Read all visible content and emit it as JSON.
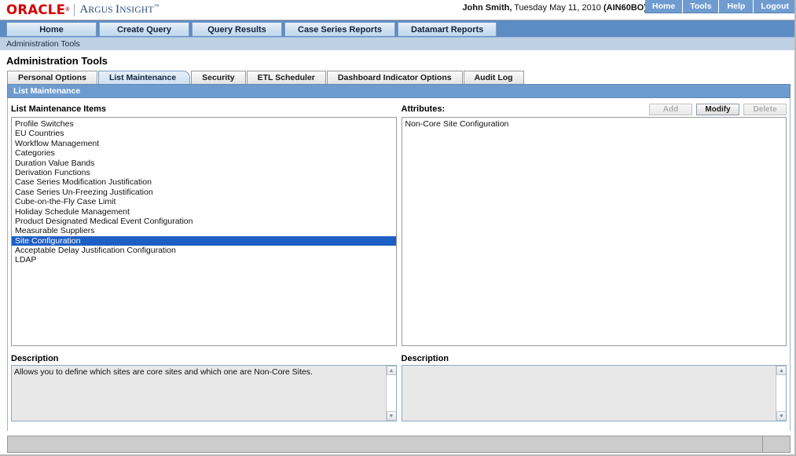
{
  "branding": {
    "oracle": "ORACLE",
    "oracle_tm": "®",
    "product_line1": "A",
    "product": "RGUS ",
    "product_i": "I",
    "product2": "NSIGHT",
    "product_tm": "™"
  },
  "user": {
    "name": "John Smith,",
    "date": " Tuesday May 11, 2010 ",
    "code": "(AIN60BO)"
  },
  "topnav": [
    {
      "label": "Home"
    },
    {
      "label": "Tools"
    },
    {
      "label": "Help"
    },
    {
      "label": "Logout"
    }
  ],
  "mainnav": [
    {
      "label": "Home"
    },
    {
      "label": "Create Query"
    },
    {
      "label": "Query Results"
    },
    {
      "label": "Case Series Reports"
    },
    {
      "label": "Datamart Reports"
    }
  ],
  "breadcrumb": "Administration Tools",
  "page_title": "Administration Tools",
  "subtabs": [
    {
      "label": "Personal Options",
      "active": false
    },
    {
      "label": "List Maintenance",
      "active": true
    },
    {
      "label": "Security",
      "active": false
    },
    {
      "label": "ETL Scheduler",
      "active": false
    },
    {
      "label": "Dashboard Indicator Options",
      "active": false
    },
    {
      "label": "Audit Log",
      "active": false
    }
  ],
  "section_header": "List Maintenance",
  "left_panel": {
    "label": "List Maintenance Items",
    "items": [
      "Profile Switches",
      "EU Countries",
      "Workflow Management",
      "Categories",
      "Duration Value Bands",
      "Derivation Functions",
      "Case Series Modification Justification",
      "Case Series Un-Freezing Justification",
      "Cube-on-the-Fly Case Limit",
      "Holiday Schedule Management",
      "Product Designated Medical Event Configuration",
      "Measurable Suppliers",
      "Site Configuration",
      "Acceptable Delay Justification Configuration",
      "LDAP"
    ],
    "selected_index": 12,
    "description_label": "Description",
    "description_text": "Allows you to define which sites are core sites and which one are Non-Core Sites."
  },
  "right_panel": {
    "label": "Attributes:",
    "buttons": [
      {
        "label": "Add",
        "enabled": false
      },
      {
        "label": "Modify",
        "enabled": true
      },
      {
        "label": "Delete",
        "enabled": false
      }
    ],
    "items": [
      "Non-Core Site Configuration"
    ],
    "description_label": "Description",
    "description_text": ""
  },
  "scroll": {
    "up": "▲",
    "down": "▼"
  },
  "colors": {
    "oracle_red": "#d40000",
    "brand_blue": "#2c4a7c",
    "nav_blue": "#5c8cc4",
    "section_blue": "#6f9cd0",
    "selection_blue": "#1d5fc4",
    "crumb_blue": "#bed0e4"
  },
  "status_bar": ""
}
